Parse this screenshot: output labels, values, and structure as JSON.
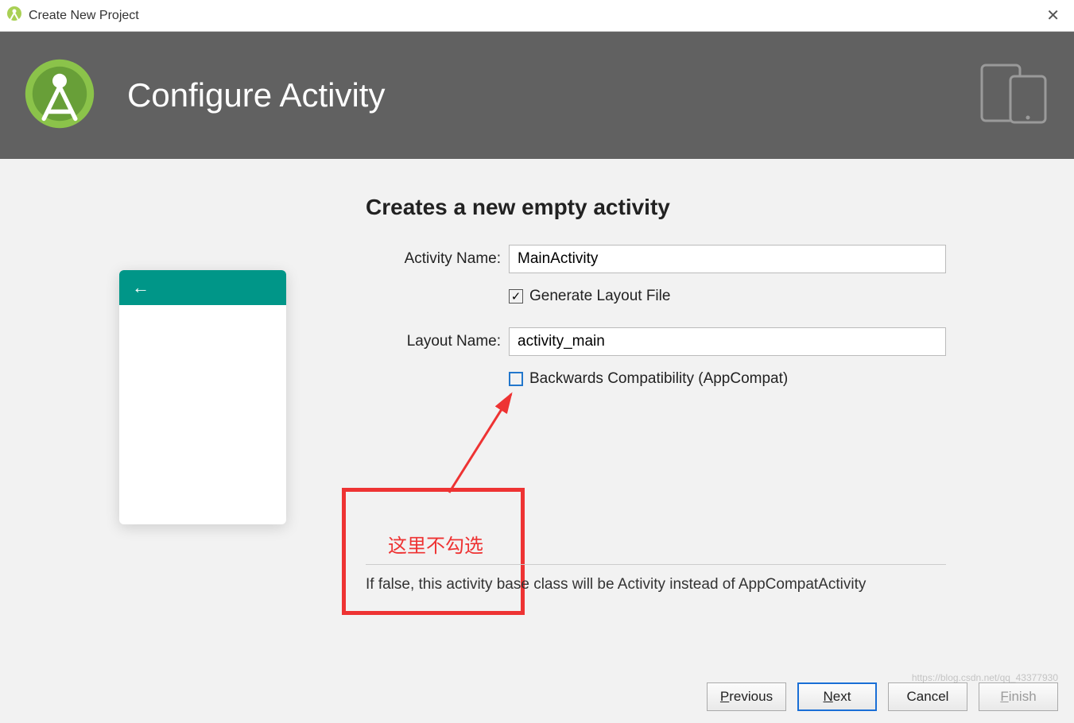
{
  "titlebar": {
    "title": "Create New Project"
  },
  "banner": {
    "title": "Configure Activity"
  },
  "form": {
    "heading": "Creates a new empty activity",
    "activity_label": "Activity Name:",
    "activity_value": "MainActivity",
    "generate_layout_label": "Generate Layout File",
    "generate_layout_checked": true,
    "layout_label": "Layout Name:",
    "layout_value": "activity_main",
    "backwards_label": "Backwards Compatibility (AppCompat)",
    "backwards_checked": false,
    "help_text": "If false, this activity base class will be Activity instead of AppCompatActivity"
  },
  "buttons": {
    "previous": "Previous",
    "next": "Next",
    "cancel": "Cancel",
    "finish": "Finish"
  },
  "preview": {
    "back_arrow": "←"
  },
  "annotation": {
    "text": "这里不勾选"
  },
  "watermark": "https://blog.csdn.net/qq_43377930"
}
